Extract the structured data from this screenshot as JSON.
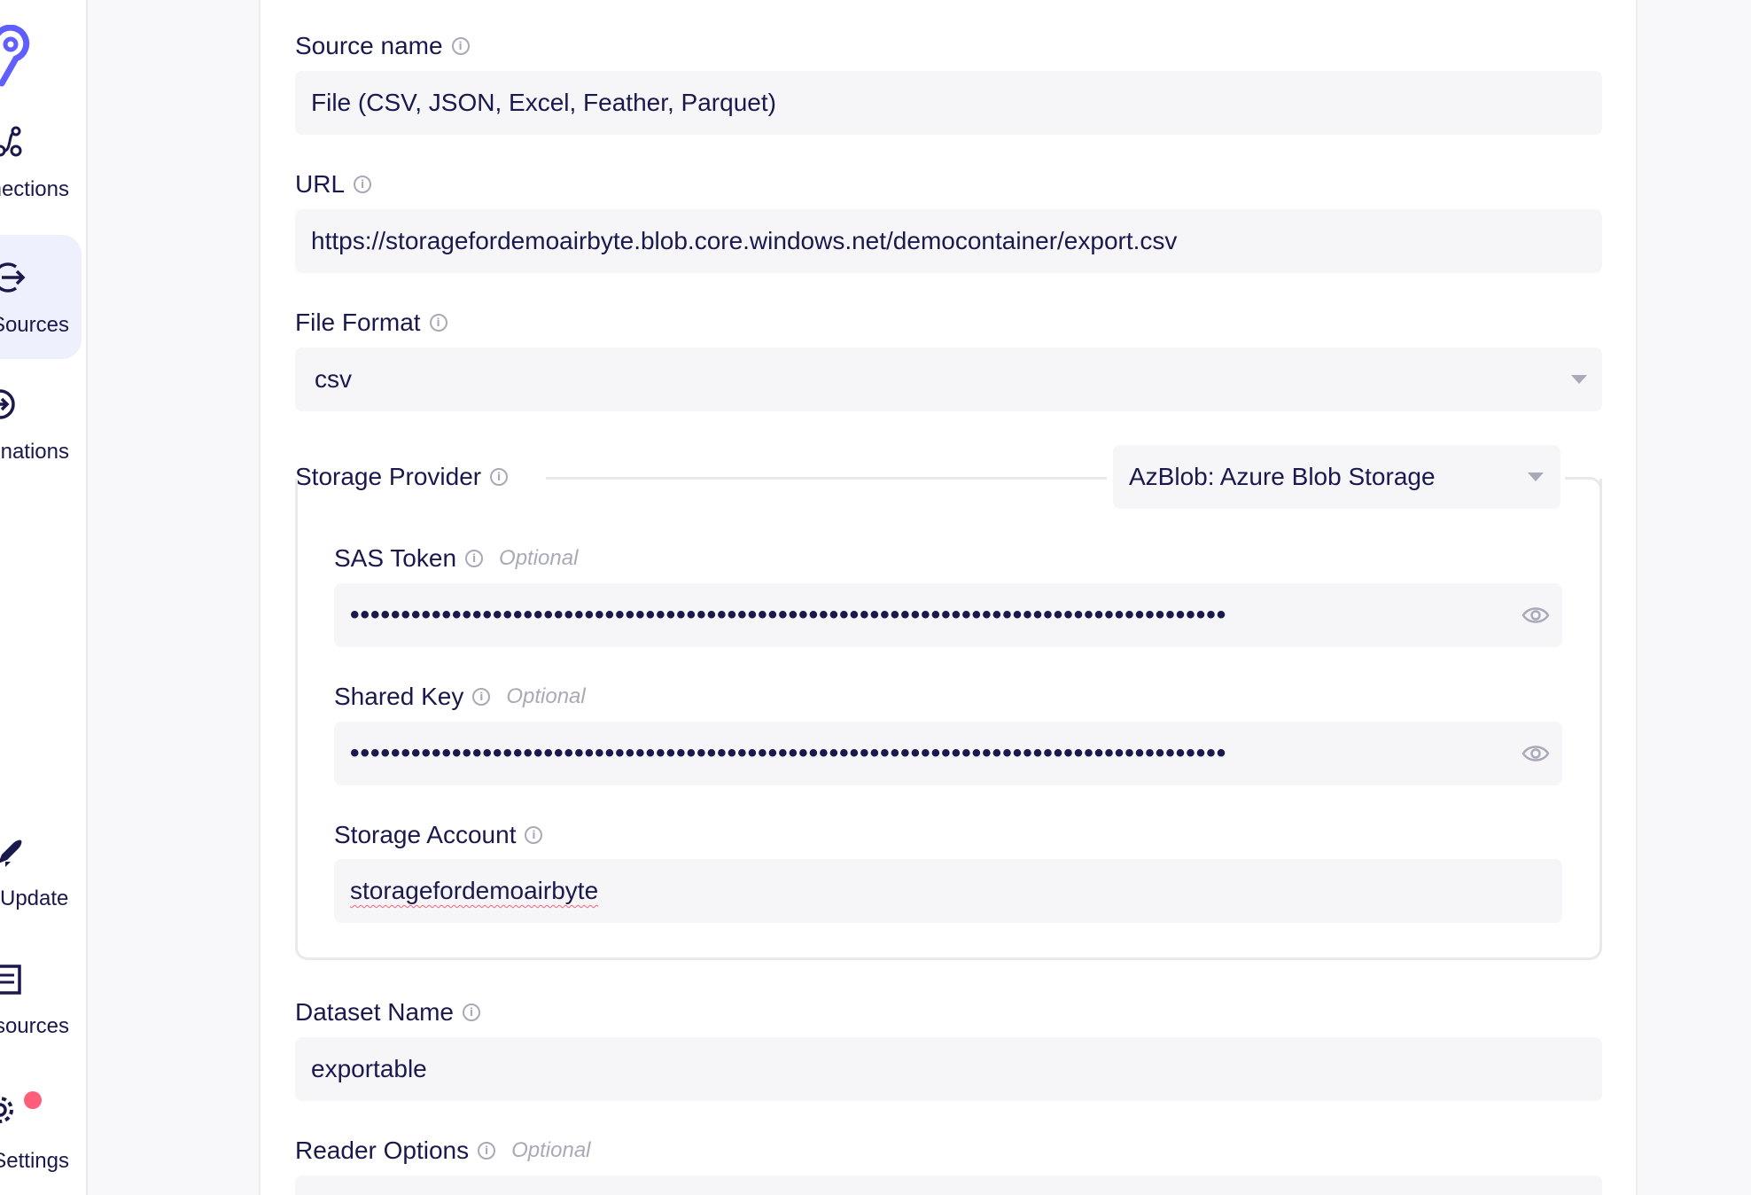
{
  "sidebar": {
    "items": [
      {
        "label": "Connections",
        "icon": "connections-icon"
      },
      {
        "label": "Sources",
        "icon": "sources-icon"
      },
      {
        "label": "Destinations",
        "icon": "destinations-icon"
      },
      {
        "label": "Update",
        "icon": "rocket-icon"
      },
      {
        "label": "Resources",
        "icon": "book-icon"
      },
      {
        "label": "Settings",
        "icon": "gear-icon"
      }
    ]
  },
  "form": {
    "source_name": {
      "label": "Source name",
      "value": "File (CSV, JSON, Excel, Feather, Parquet)"
    },
    "url": {
      "label": "URL",
      "value": "https://storagefordemoairbyte.blob.core.windows.net/democontainer/export.csv"
    },
    "file_format": {
      "label": "File Format",
      "value": "csv"
    },
    "storage_provider": {
      "label": "Storage Provider",
      "value": "AzBlob: Azure Blob Storage",
      "sas_token": {
        "label": "SAS Token",
        "optional": "Optional",
        "value": "••••••••••••••••••••••••••••••••••••••••••••••••••••••••••••••••••••••••••••••••••••••"
      },
      "shared_key": {
        "label": "Shared Key",
        "optional": "Optional",
        "value": "••••••••••••••••••••••••••••••••••••••••••••••••••••••••••••••••••••••••••••••••••••••"
      },
      "storage_account": {
        "label": "Storage Account",
        "value": "storagefordemoairbyte"
      }
    },
    "dataset_name": {
      "label": "Dataset Name",
      "value": "exportable"
    },
    "reader_options": {
      "label": "Reader Options",
      "optional": "Optional"
    }
  },
  "colors": {
    "accent": "#615eff",
    "text": "#1a194d",
    "notification": "#ff5e7b"
  }
}
